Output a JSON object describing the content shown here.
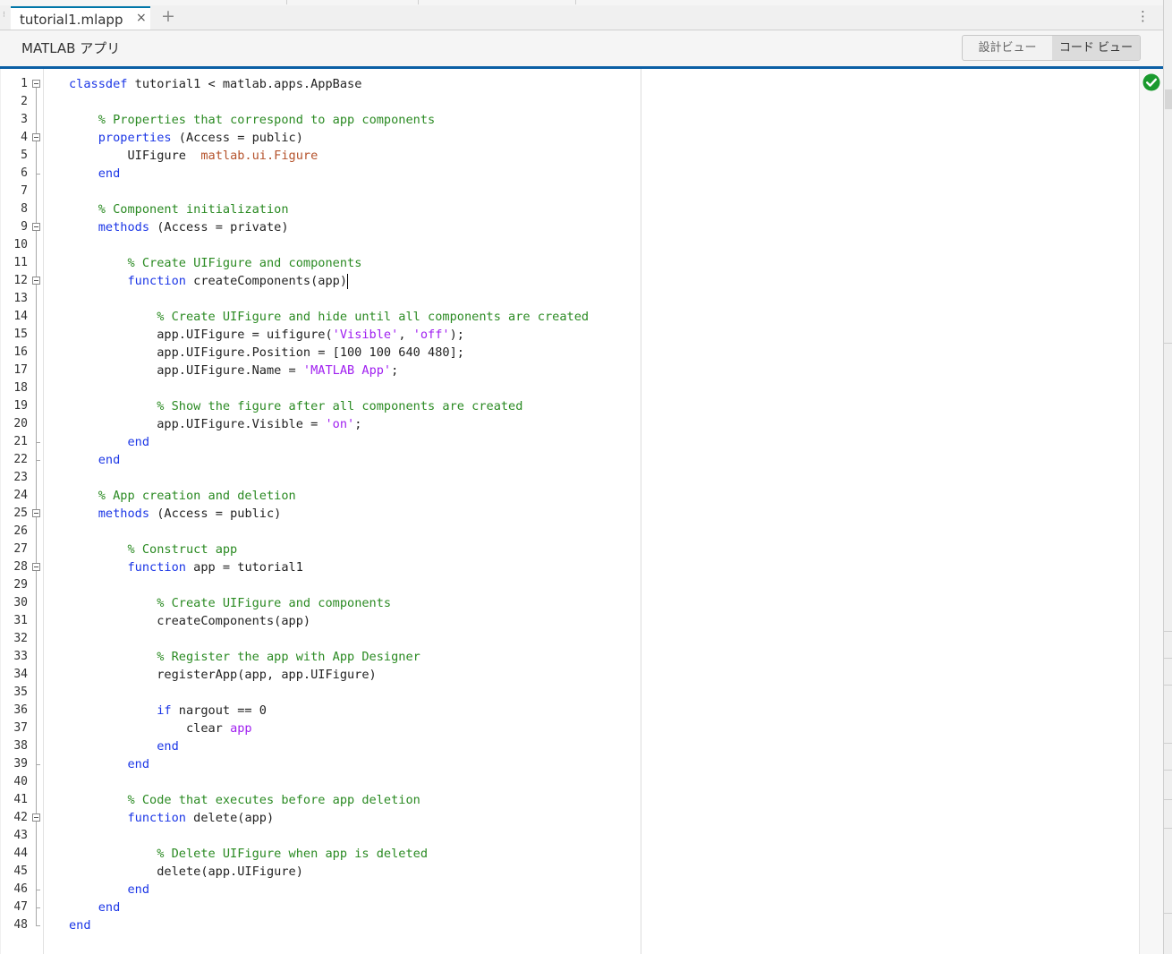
{
  "tab": {
    "filename": "tutorial1.mlapp",
    "close_glyph": "×",
    "add_glyph": "+"
  },
  "header": {
    "title": "MATLAB アプリ",
    "design_view": "設計ビュー",
    "code_view": "コード ビュー"
  },
  "colors": {
    "keyword": "#1b36e6",
    "comment": "#2a8a22",
    "string": "#a020f0",
    "type": "#b5532c",
    "accent": "#0b5fa5",
    "ok": "#1a9a2e"
  },
  "status": {
    "icon": "check-circle-icon"
  },
  "code_lines": [
    [
      {
        "t": "classdef",
        "c": "kw"
      },
      {
        "t": " tutorial1 < matlab.apps.AppBase"
      }
    ],
    [],
    [
      {
        "t": "    "
      },
      {
        "t": "% Properties that correspond to app components",
        "c": "cm"
      }
    ],
    [
      {
        "t": "    "
      },
      {
        "t": "properties",
        "c": "kw"
      },
      {
        "t": " (Access = public)"
      }
    ],
    [
      {
        "t": "        UIFigure  "
      },
      {
        "t": "matlab.ui.Figure",
        "c": "ty"
      }
    ],
    [
      {
        "t": "    "
      },
      {
        "t": "end",
        "c": "kw"
      }
    ],
    [],
    [
      {
        "t": "    "
      },
      {
        "t": "% Component initialization",
        "c": "cm"
      }
    ],
    [
      {
        "t": "    "
      },
      {
        "t": "methods",
        "c": "kw"
      },
      {
        "t": " (Access = private)"
      }
    ],
    [],
    [
      {
        "t": "        "
      },
      {
        "t": "% Create UIFigure and components",
        "c": "cm"
      }
    ],
    [
      {
        "t": "        "
      },
      {
        "t": "function",
        "c": "kw"
      },
      {
        "t": " createComponents(app)"
      }
    ],
    [],
    [
      {
        "t": "            "
      },
      {
        "t": "% Create UIFigure and hide until all components are created",
        "c": "cm"
      }
    ],
    [
      {
        "t": "            app.UIFigure = uifigure("
      },
      {
        "t": "'Visible'",
        "c": "st"
      },
      {
        "t": ", "
      },
      {
        "t": "'off'",
        "c": "st"
      },
      {
        "t": ");"
      }
    ],
    [
      {
        "t": "            app.UIFigure.Position = [100 100 640 480];"
      }
    ],
    [
      {
        "t": "            app.UIFigure.Name = "
      },
      {
        "t": "'MATLAB App'",
        "c": "st"
      },
      {
        "t": ";"
      }
    ],
    [],
    [
      {
        "t": "            "
      },
      {
        "t": "% Show the figure after all components are created",
        "c": "cm"
      }
    ],
    [
      {
        "t": "            app.UIFigure.Visible = "
      },
      {
        "t": "'on'",
        "c": "st"
      },
      {
        "t": ";"
      }
    ],
    [
      {
        "t": "        "
      },
      {
        "t": "end",
        "c": "kw"
      }
    ],
    [
      {
        "t": "    "
      },
      {
        "t": "end",
        "c": "kw"
      }
    ],
    [],
    [
      {
        "t": "    "
      },
      {
        "t": "% App creation and deletion",
        "c": "cm"
      }
    ],
    [
      {
        "t": "    "
      },
      {
        "t": "methods",
        "c": "kw"
      },
      {
        "t": " (Access = public)"
      }
    ],
    [],
    [
      {
        "t": "        "
      },
      {
        "t": "% Construct app",
        "c": "cm"
      }
    ],
    [
      {
        "t": "        "
      },
      {
        "t": "function",
        "c": "kw"
      },
      {
        "t": " app = tutorial1"
      }
    ],
    [],
    [
      {
        "t": "            "
      },
      {
        "t": "% Create UIFigure and components",
        "c": "cm"
      }
    ],
    [
      {
        "t": "            createComponents(app)"
      }
    ],
    [],
    [
      {
        "t": "            "
      },
      {
        "t": "% Register the app with App Designer",
        "c": "cm"
      }
    ],
    [
      {
        "t": "            registerApp(app, app.UIFigure)"
      }
    ],
    [],
    [
      {
        "t": "            "
      },
      {
        "t": "if",
        "c": "kw"
      },
      {
        "t": " nargout == 0"
      }
    ],
    [
      {
        "t": "                clear "
      },
      {
        "t": "app",
        "c": "st"
      }
    ],
    [
      {
        "t": "            "
      },
      {
        "t": "end",
        "c": "kw"
      }
    ],
    [
      {
        "t": "        "
      },
      {
        "t": "end",
        "c": "kw"
      }
    ],
    [],
    [
      {
        "t": "        "
      },
      {
        "t": "% Code that executes before app deletion",
        "c": "cm"
      }
    ],
    [
      {
        "t": "        "
      },
      {
        "t": "function",
        "c": "kw"
      },
      {
        "t": " delete(app)"
      }
    ],
    [],
    [
      {
        "t": "            "
      },
      {
        "t": "% Delete UIFigure when app is deleted",
        "c": "cm"
      }
    ],
    [
      {
        "t": "            delete(app.UIFigure)"
      }
    ],
    [
      {
        "t": "        "
      },
      {
        "t": "end",
        "c": "kw"
      }
    ],
    [
      {
        "t": "    "
      },
      {
        "t": "end",
        "c": "kw"
      }
    ],
    [
      {
        "t": "end",
        "c": "kw"
      }
    ]
  ],
  "line_numbers": [
    "1",
    "2",
    "3",
    "4",
    "5",
    "6",
    "7",
    "8",
    "9",
    "10",
    "11",
    "12",
    "13",
    "14",
    "15",
    "16",
    "17",
    "18",
    "19",
    "20",
    "21",
    "22",
    "23",
    "24",
    "25",
    "26",
    "27",
    "28",
    "29",
    "30",
    "31",
    "32",
    "33",
    "34",
    "35",
    "36",
    "37",
    "38",
    "39",
    "40",
    "41",
    "42",
    "43",
    "44",
    "45",
    "46",
    "47",
    "48"
  ],
  "cursor_line": 12
}
